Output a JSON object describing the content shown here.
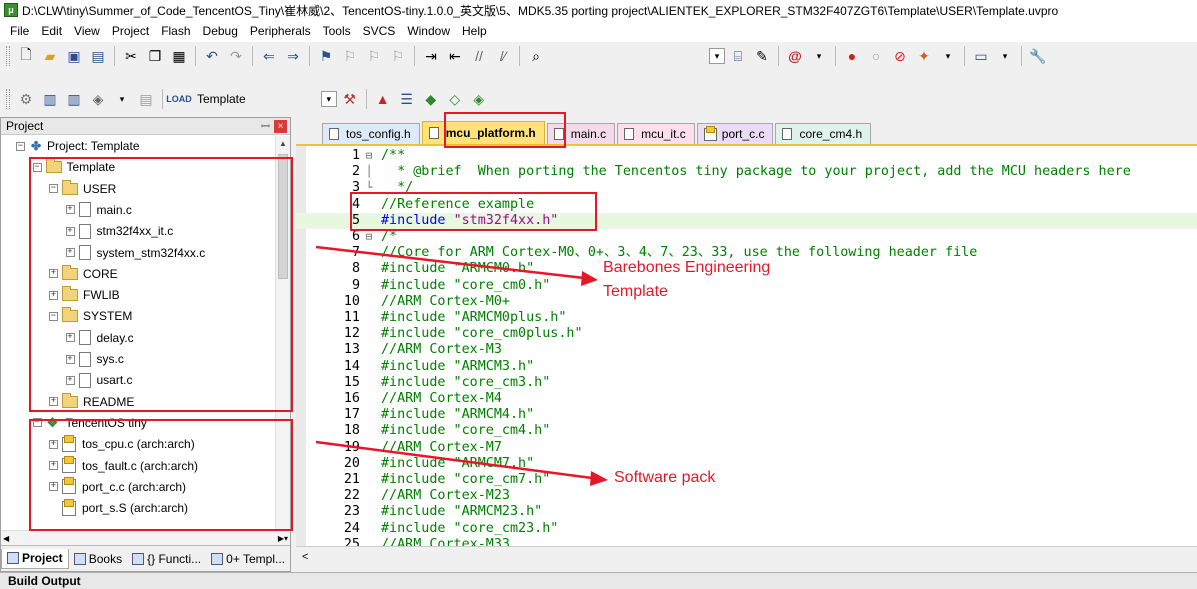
{
  "window": {
    "title": "D:\\CLW\\tiny\\Summer_of_Code_TencentOS_Tiny\\崔林威\\2、TencentOS-tiny.1.0.0_英文版\\5、MDK5.35 porting project\\ALIENTEK_EXPLORER_STM32F407ZGT6\\Template\\USER\\Template.uvpro"
  },
  "menu": [
    "File",
    "Edit",
    "View",
    "Project",
    "Flash",
    "Debug",
    "Peripherals",
    "Tools",
    "SVCS",
    "Window",
    "Help"
  ],
  "toolbar": {
    "target_label": "Template"
  },
  "project_panel": {
    "title": "Project",
    "close_symbol": "×",
    "pin_symbol": "ꟷ",
    "tree": [
      {
        "label": "Project: Template",
        "level": 0,
        "icon": "project-icon",
        "expander": "−"
      },
      {
        "label": "Template",
        "level": 1,
        "icon": "folder-icon",
        "expander": "−"
      },
      {
        "label": "USER",
        "level": 2,
        "icon": "folder-icon",
        "expander": "−"
      },
      {
        "label": "main.c",
        "level": 3,
        "icon": "file-icon",
        "expander": "+"
      },
      {
        "label": "stm32f4xx_it.c",
        "level": 3,
        "icon": "file-icon",
        "expander": "+"
      },
      {
        "label": "system_stm32f4xx.c",
        "level": 3,
        "icon": "file-icon",
        "expander": "+"
      },
      {
        "label": "CORE",
        "level": 2,
        "icon": "folder-icon",
        "expander": "+"
      },
      {
        "label": "FWLIB",
        "level": 2,
        "icon": "folder-icon",
        "expander": "+"
      },
      {
        "label": "SYSTEM",
        "level": 2,
        "icon": "folder-icon",
        "expander": "−"
      },
      {
        "label": "delay.c",
        "level": 3,
        "icon": "file-icon",
        "expander": "+"
      },
      {
        "label": "sys.c",
        "level": 3,
        "icon": "file-icon",
        "expander": "+"
      },
      {
        "label": "usart.c",
        "level": 3,
        "icon": "file-icon",
        "expander": "+"
      },
      {
        "label": "README",
        "level": 2,
        "icon": "folder-icon",
        "expander": "+"
      },
      {
        "label": "TencentOS tiny",
        "level": 1,
        "icon": "software-pack-icon",
        "expander": "−"
      },
      {
        "label": "tos_cpu.c (arch:arch)",
        "level": 2,
        "icon": "component-file-icon",
        "expander": "+"
      },
      {
        "label": "tos_fault.c (arch:arch)",
        "level": 2,
        "icon": "component-file-icon",
        "expander": "+"
      },
      {
        "label": "port_c.c (arch:arch)",
        "level": 2,
        "icon": "component-file-icon",
        "expander": "+"
      },
      {
        "label": "port_s.S (arch:arch)",
        "level": 2,
        "icon": "component-file-icon",
        "expander": ""
      }
    ],
    "bottom_tabs": [
      "Project",
      "Books",
      "{} Functi...",
      "0+ Templ..."
    ]
  },
  "editor": {
    "tabs": [
      {
        "label": "tos_config.h",
        "active": false,
        "icon": "file-icon"
      },
      {
        "label": "mcu_platform.h",
        "active": true,
        "icon": "file-icon"
      },
      {
        "label": "main.c",
        "active": false,
        "icon": "file-icon"
      },
      {
        "label": "mcu_it.c",
        "active": false,
        "icon": "file-icon"
      },
      {
        "label": "port_c.c",
        "active": false,
        "icon": "component-file-icon"
      },
      {
        "label": "core_cm4.h",
        "active": false,
        "icon": "file-icon"
      }
    ],
    "lines": [
      {
        "n": "1",
        "fold": "⊟",
        "parts": [
          {
            "t": "/**",
            "c": "cmt"
          }
        ]
      },
      {
        "n": "2",
        "fold": "│",
        "parts": [
          {
            "t": "  * @brief  When porting the Tencentos tiny package to your project, add the MCU headers here",
            "c": "cmt"
          }
        ]
      },
      {
        "n": "3",
        "fold": "└",
        "parts": [
          {
            "t": "  */",
            "c": "cmt"
          }
        ]
      },
      {
        "n": "4",
        "fold": "",
        "parts": [
          {
            "t": "//Reference example",
            "c": "cmt"
          }
        ]
      },
      {
        "n": "5",
        "fold": "",
        "hl": true,
        "parts": [
          {
            "t": "#include ",
            "c": "dir"
          },
          {
            "t": "\"stm32f4xx.h\"",
            "c": "str"
          }
        ]
      },
      {
        "n": "6",
        "fold": "⊟",
        "parts": [
          {
            "t": "/*",
            "c": "cmt"
          }
        ]
      },
      {
        "n": "7",
        "fold": "",
        "parts": [
          {
            "t": "//Core for ARM Cortex-M0、0+、3、4、7、23、33, use the following header file",
            "c": "cmt"
          }
        ]
      },
      {
        "n": "8",
        "fold": "",
        "parts": [
          {
            "t": "#include \"ARMCM0.h\"",
            "c": "cmt"
          }
        ]
      },
      {
        "n": "9",
        "fold": "",
        "parts": [
          {
            "t": "#include \"core_cm0.h\"",
            "c": "cmt"
          }
        ]
      },
      {
        "n": "10",
        "fold": "",
        "parts": [
          {
            "t": "//ARM Cortex-M0+",
            "c": "cmt"
          }
        ]
      },
      {
        "n": "11",
        "fold": "",
        "parts": [
          {
            "t": "#include \"ARMCM0plus.h\"",
            "c": "cmt"
          }
        ]
      },
      {
        "n": "12",
        "fold": "",
        "parts": [
          {
            "t": "#include \"core_cm0plus.h\"",
            "c": "cmt"
          }
        ]
      },
      {
        "n": "13",
        "fold": "",
        "parts": [
          {
            "t": "//ARM Cortex-M3",
            "c": "cmt"
          }
        ]
      },
      {
        "n": "14",
        "fold": "",
        "parts": [
          {
            "t": "#include \"ARMCM3.h\"",
            "c": "cmt"
          }
        ]
      },
      {
        "n": "15",
        "fold": "",
        "parts": [
          {
            "t": "#include \"core_cm3.h\"",
            "c": "cmt"
          }
        ]
      },
      {
        "n": "16",
        "fold": "",
        "parts": [
          {
            "t": "//ARM Cortex-M4",
            "c": "cmt"
          }
        ]
      },
      {
        "n": "17",
        "fold": "",
        "parts": [
          {
            "t": "#include \"ARMCM4.h\"",
            "c": "cmt"
          }
        ]
      },
      {
        "n": "18",
        "fold": "",
        "parts": [
          {
            "t": "#include \"core_cm4.h\"",
            "c": "cmt"
          }
        ]
      },
      {
        "n": "19",
        "fold": "",
        "parts": [
          {
            "t": "//ARM Cortex-M7",
            "c": "cmt"
          }
        ]
      },
      {
        "n": "20",
        "fold": "",
        "parts": [
          {
            "t": "#include \"ARMCM7.h\"",
            "c": "cmt"
          }
        ]
      },
      {
        "n": "21",
        "fold": "",
        "parts": [
          {
            "t": "#include \"core_cm7.h\"",
            "c": "cmt"
          }
        ]
      },
      {
        "n": "22",
        "fold": "",
        "parts": [
          {
            "t": "//ARM Cortex-M23",
            "c": "cmt"
          }
        ]
      },
      {
        "n": "23",
        "fold": "",
        "parts": [
          {
            "t": "#include \"ARMCM23.h\"",
            "c": "cmt"
          }
        ]
      },
      {
        "n": "24",
        "fold": "",
        "parts": [
          {
            "t": "#include \"core_cm23.h\"",
            "c": "cmt"
          }
        ]
      },
      {
        "n": "25",
        "fold": "",
        "parts": [
          {
            "t": "//ARM Cortex-M33",
            "c": "cmt"
          }
        ]
      }
    ]
  },
  "annotations": {
    "label_barebones_line1": "Barebones Engineering",
    "label_barebones_line2": "Template",
    "label_software_pack": "Software pack",
    "color": "#e5182a"
  },
  "build_output": {
    "title": "Build Output"
  }
}
